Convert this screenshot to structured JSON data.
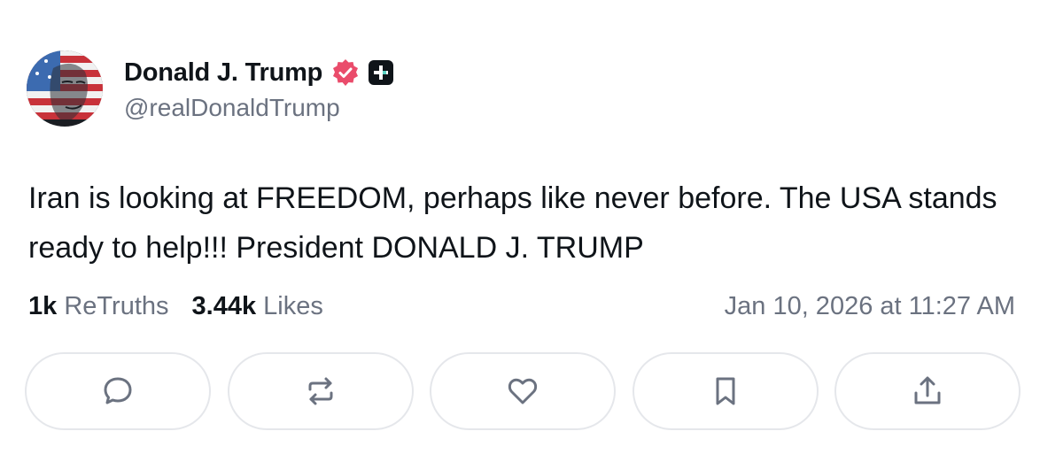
{
  "post": {
    "author": {
      "display_name": "Donald J. Trump",
      "handle": "@realDonaldTrump",
      "avatar_icon": "flag-portrait-avatar",
      "verified_icon": "verified-badge-icon",
      "verified_color": "#ea4c6b",
      "plus_icon": "plus-badge-icon"
    },
    "text": "Iran is looking at FREEDOM, perhaps like never before. The USA stands ready to help!!! President DONALD J. TRUMP",
    "stats": {
      "retruths_count": "1k",
      "retruths_label": "ReTruths",
      "likes_count": "3.44k",
      "likes_label": "Likes"
    },
    "timestamp": "Jan 10, 2026 at 11:27 AM"
  },
  "actions": [
    {
      "name": "reply",
      "icon": "comment-icon"
    },
    {
      "name": "retruth",
      "icon": "repost-icon"
    },
    {
      "name": "like",
      "icon": "heart-icon"
    },
    {
      "name": "bookmark",
      "icon": "bookmark-icon"
    },
    {
      "name": "share",
      "icon": "share-icon"
    }
  ],
  "colors": {
    "text_primary": "#0f1419",
    "text_secondary": "#6b7280",
    "border": "#e5e7eb",
    "icon": "#6b7280"
  }
}
